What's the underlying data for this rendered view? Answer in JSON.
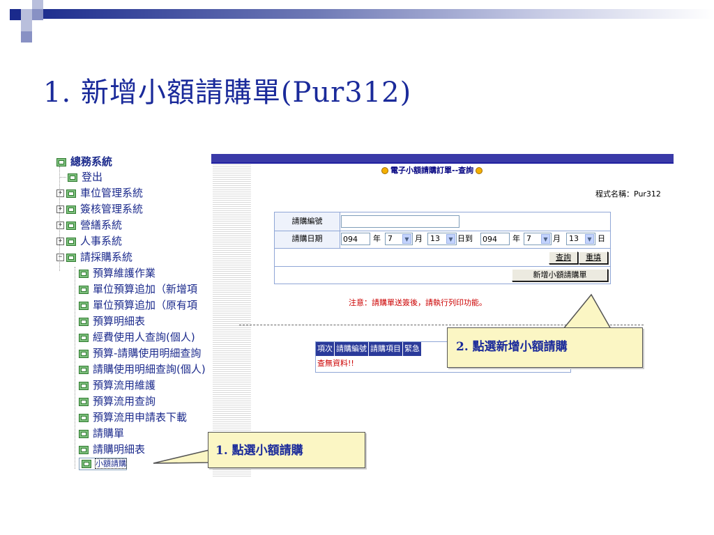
{
  "slide": {
    "title": "1. 新增小額請購單(Pur312)"
  },
  "tree": {
    "root": "總務系統",
    "items": [
      {
        "label": "登出"
      },
      {
        "label": "車位管理系統"
      },
      {
        "label": "簽核管理系統"
      },
      {
        "label": "營繕系統"
      },
      {
        "label": "人事系統"
      },
      {
        "label": "請採購系統"
      }
    ],
    "children": [
      {
        "label": "預算維護作業"
      },
      {
        "label": "單位預算追加（新增項"
      },
      {
        "label": "單位預算追加（原有項"
      },
      {
        "label": "預算明細表"
      },
      {
        "label": "經費使用人查詢(個人)"
      },
      {
        "label": "預算-請購使用明細查詢"
      },
      {
        "label": "請購使用明細查詢(個人)"
      },
      {
        "label": "預算流用維護"
      },
      {
        "label": "預算流用查詢"
      },
      {
        "label": "預算流用申請表下載"
      },
      {
        "label": "請購單"
      },
      {
        "label": "請購明細表"
      },
      {
        "label": "小額請購"
      }
    ]
  },
  "app": {
    "title": "電子小額請購訂單--查詢",
    "program_name": "程式名稱：Pur312",
    "form": {
      "req_no_label": "請購編號",
      "req_no_value": "",
      "date_label": "請購日期",
      "from_year": "094",
      "from_month": "7",
      "from_day": "13",
      "to_year": "094",
      "to_month": "7",
      "to_day": "13",
      "unit_year": "年",
      "unit_month": "月",
      "unit_day": "日",
      "unit_day_to": "日到",
      "query_label": "查詢",
      "reset_label": "重填",
      "add_label": "新增小額請購單"
    },
    "notice": "注意：請購單送簽後，請執行列印功能。",
    "result": {
      "columns": [
        "項次",
        "請購編號",
        "請購項目",
        "緊急"
      ],
      "empty_text": "查無資料!!"
    }
  },
  "callouts": {
    "step1": "1. 點選小額請購",
    "step2": "2. 點選新增小額請購"
  },
  "colors": {
    "title": "#1a2a9a",
    "header_bar": "#3a3aa8",
    "notice": "#cc0000",
    "callout_bg": "#fbf6c4"
  }
}
